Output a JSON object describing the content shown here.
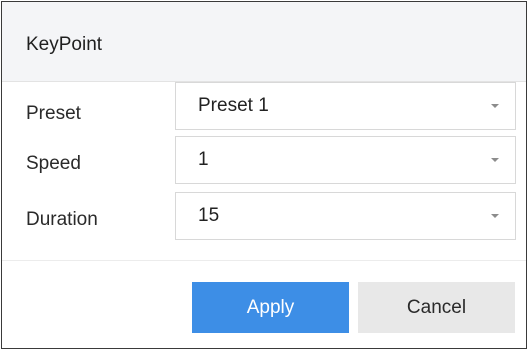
{
  "dialog": {
    "title": "KeyPoint",
    "fields": [
      {
        "label": "Preset",
        "value": "Preset 1"
      },
      {
        "label": "Speed",
        "value": "1"
      },
      {
        "label": "Duration",
        "value": "15"
      }
    ],
    "buttons": {
      "apply": "Apply",
      "cancel": "Cancel"
    }
  },
  "colors": {
    "accent": "#3d8ee6",
    "titlebar_bg": "#f4f5f7",
    "cancel_bg": "#e8e8e8"
  },
  "icons": {
    "dropdown": "chevron-down-icon"
  }
}
